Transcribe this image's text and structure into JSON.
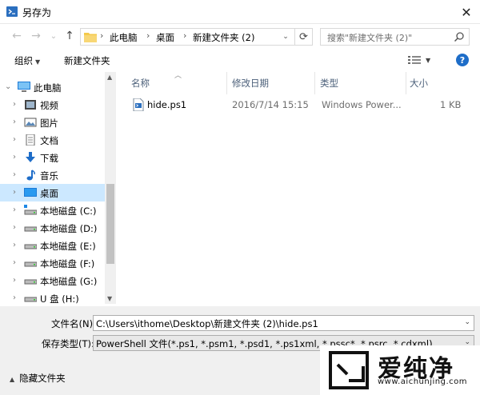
{
  "window": {
    "title": "另存为",
    "close_glyph": "✕"
  },
  "nav": {
    "back_glyph": "←",
    "forward_glyph": "→",
    "recent_glyph": "⌄",
    "up_glyph": "↑",
    "breadcrumb": [
      "此电脑",
      "桌面",
      "新建文件夹 (2)"
    ],
    "breadcrumb_sep": "›",
    "dropdown_glyph": "⌄",
    "refresh_glyph": "⟳",
    "search_placeholder": "搜索\"新建文件夹 (2)\""
  },
  "toolbar": {
    "organize_label": "组织",
    "new_folder_label": "新建文件夹",
    "help_glyph": "?",
    "dropdown_glyph": "▼"
  },
  "sidebar": {
    "items": [
      {
        "label": "此电脑",
        "icon": "computer-icon"
      },
      {
        "label": "视频",
        "icon": "video-icon"
      },
      {
        "label": "图片",
        "icon": "picture-icon"
      },
      {
        "label": "文档",
        "icon": "document-icon"
      },
      {
        "label": "下载",
        "icon": "download-icon"
      },
      {
        "label": "音乐",
        "icon": "music-icon"
      },
      {
        "label": "桌面",
        "icon": "desktop-icon",
        "selected": true
      },
      {
        "label": "本地磁盘 (C:)",
        "icon": "drive-icon"
      },
      {
        "label": "本地磁盘 (D:)",
        "icon": "drive-icon"
      },
      {
        "label": "本地磁盘 (E:)",
        "icon": "drive-icon"
      },
      {
        "label": "本地磁盘 (F:)",
        "icon": "drive-icon"
      },
      {
        "label": "本地磁盘 (G:)",
        "icon": "drive-icon"
      },
      {
        "label": "U 盘 (H:)",
        "icon": "usb-drive-icon"
      }
    ]
  },
  "columns": {
    "name": "名称",
    "modified": "修改日期",
    "type": "类型",
    "size": "大小"
  },
  "files": [
    {
      "name": "hide.ps1",
      "modified": "2016/7/14 15:15",
      "type": "Windows Power...",
      "size": "1 KB"
    }
  ],
  "save": {
    "filename_label": "文件名(N):",
    "filename_value": "C:\\Users\\ithome\\Desktop\\新建文件夹 (2)\\hide.ps1",
    "filetype_label": "保存类型(T):",
    "filetype_value": "PowerShell 文件(*.ps1, *.psm1, *.psd1, *.ps1xml, *.pssc*, *.psrc, *.cdxml)",
    "hide_folders_label": "隐藏文件夹",
    "hide_folders_glyph": "▲"
  },
  "watermark": {
    "text": "爱纯净",
    "url": "www.aichunjing.com"
  }
}
